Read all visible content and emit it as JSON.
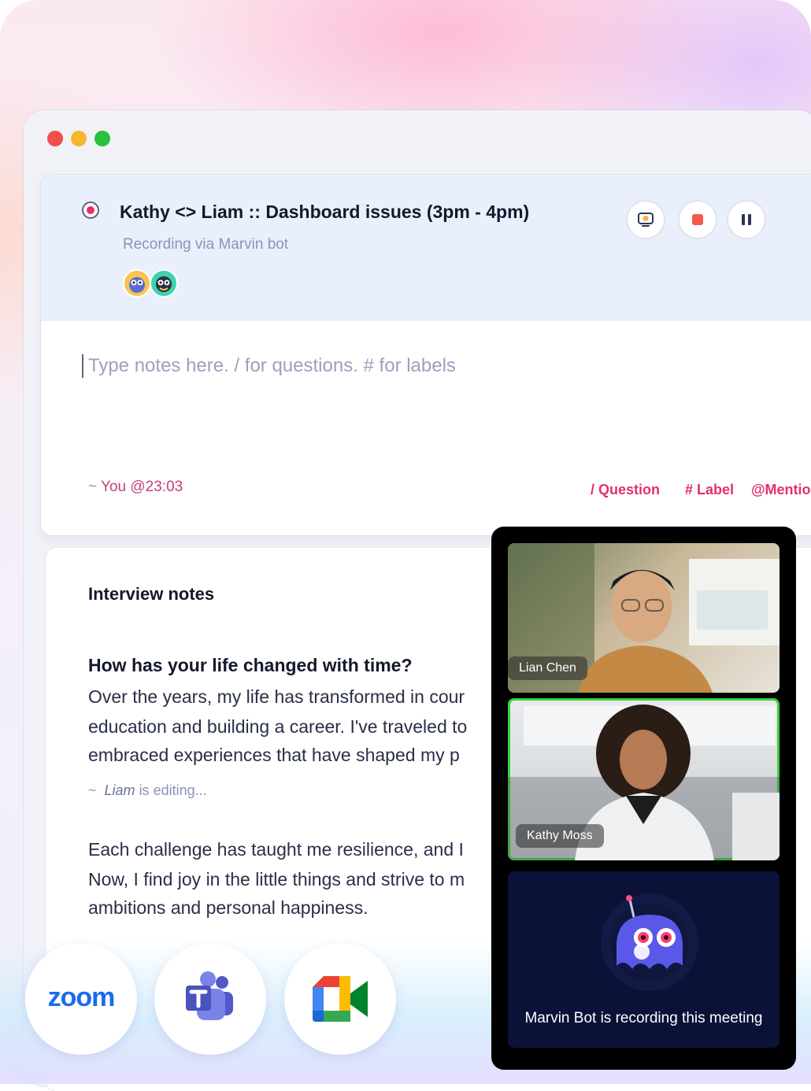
{
  "meeting": {
    "title": "Kathy <> Liam :: Dashboard issues (3pm - 4pm)",
    "subtitle": "Recording via Marvin bot"
  },
  "notes": {
    "placeholder": "Type notes here. / for questions. # for labels",
    "author_prefix": "~ ",
    "author": "You ",
    "timestamp": "@23:03",
    "tags": [
      "/ Question",
      "# Label",
      "@Mentio"
    ]
  },
  "interview": {
    "title": "Interview notes",
    "question": "How has your life changed with time?",
    "paragraph1": [
      "Over the years, my life has transformed in cour",
      "education and building a career. I've traveled to",
      "embraced experiences that have shaped my p"
    ],
    "editing_prefix": "~",
    "editing_user": "Liam",
    "editing_suffix": "is editing...",
    "paragraph2": [
      "Each challenge has taught me resilience, and I",
      "Now, I find joy in the little things and strive to m",
      "ambitions and personal happiness."
    ]
  },
  "video": {
    "participants": [
      "Lian Chen",
      "Kathy Moss"
    ],
    "bot_status": "Marvin Bot is recording this meeting"
  },
  "apps": {
    "zoom_label": "zoom"
  },
  "icons": [
    "record-icon",
    "screen-bot-icon",
    "stop-icon",
    "pause-icon",
    "zoom-logo-icon",
    "teams-logo-icon",
    "google-meet-logo-icon",
    "marvin-bot-icon"
  ],
  "colors": {
    "accent": "#e62d6f",
    "record": "#ee2c64",
    "active_speaker": "#3ad23f"
  }
}
